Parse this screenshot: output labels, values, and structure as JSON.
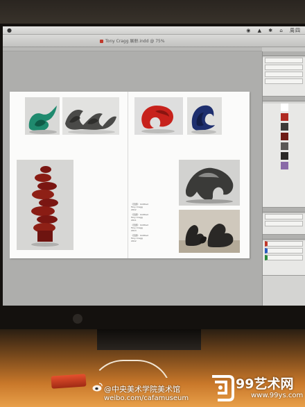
{
  "window": {
    "title": "Tony Cragg 展册.indd @ 75%"
  },
  "menubar": {
    "right_items": [
      "◉",
      "▲",
      "✱",
      "⌂",
      "周四"
    ]
  },
  "spread": {
    "captions": [
      "《无题》 Untitled",
      "Tony Cragg",
      "2012",
      "《无题》 Untitled",
      "Tony Cragg",
      "2011",
      "《无题》 Untitled",
      "Tony Cragg",
      "2013",
      "《无题》 Untitled",
      "Tony Cragg",
      "2012"
    ]
  },
  "watermarks": {
    "weibo_handle": "@中央美术学院美术馆",
    "weibo_url": "weibo.com/cafamuseum",
    "site_name": "99艺术网",
    "site_url": "www.99ys.com"
  },
  "colors": {
    "screen_bg": "#c9c9c7",
    "page": "#fbfbfa",
    "accent_red": "#c0392b",
    "desk_orange": "#c9782a"
  }
}
